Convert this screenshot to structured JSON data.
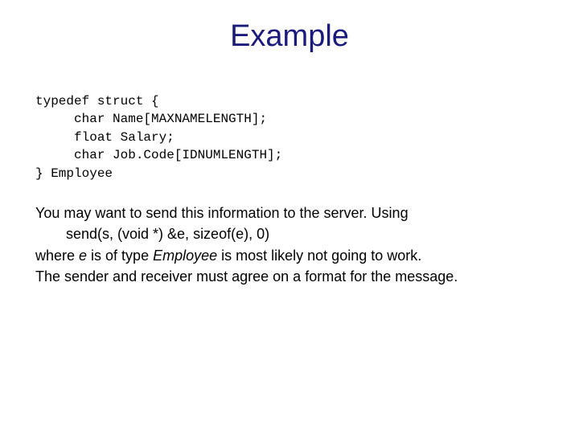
{
  "title": "Example",
  "code": {
    "l1": "typedef struct {",
    "l2": "     char Name[MAXNAMELENGTH];",
    "l3": "     float Salary;",
    "l4": "     char Job.Code[IDNUMLENGTH];",
    "l5": "} Employee"
  },
  "body": {
    "p1": "You may want to send this information to the server.  Using",
    "send": "send(s, (void *) &e, sizeof(e), 0)",
    "p2a": "where ",
    "p2b": "e",
    "p2c": " is of type ",
    "p2d": "Employee",
    "p2e": " is most likely not going to work.",
    "p3a": "The sender and receiver must agree on a format for the",
    "p3b": "message."
  }
}
